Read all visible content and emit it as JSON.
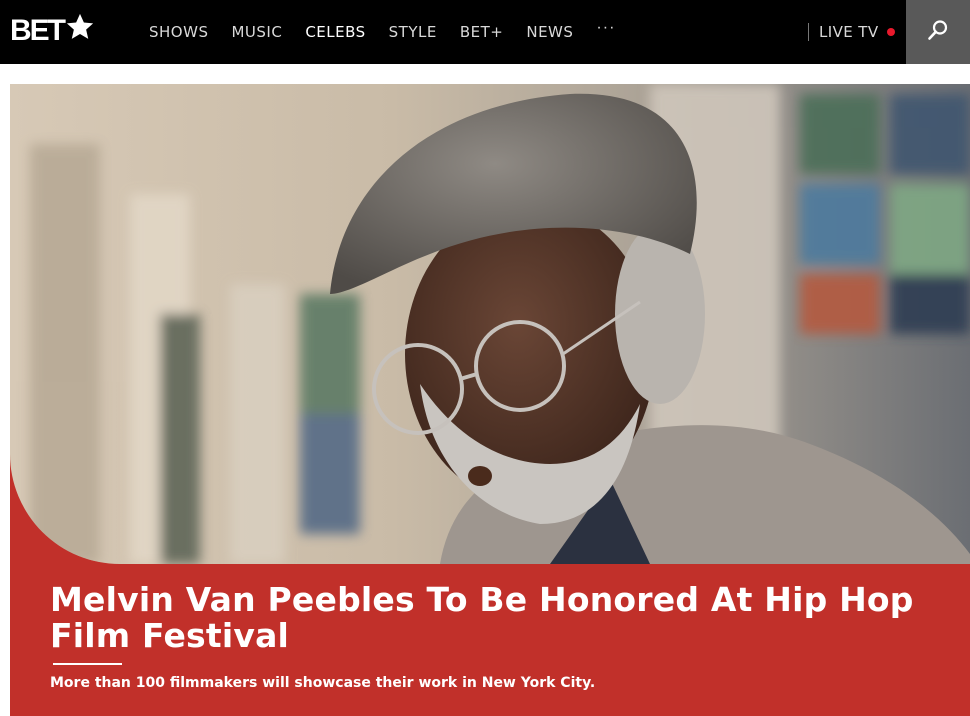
{
  "header": {
    "logo_text": "BET",
    "nav": [
      {
        "label": "SHOWS",
        "active": false
      },
      {
        "label": "MUSIC",
        "active": false
      },
      {
        "label": "CELEBS",
        "active": true
      },
      {
        "label": "STYLE",
        "active": false
      },
      {
        "label": "BET+",
        "active": false
      },
      {
        "label": "NEWS",
        "active": false
      }
    ],
    "more_label": "···",
    "live_tv_label": "LIVE TV",
    "search_icon": "search-icon"
  },
  "hero": {
    "headline": "Melvin Van Peebles To Be Honored At Hip Hop Film Festival",
    "dek": "More than 100 filmmakers will showcase their work in New York City."
  },
  "colors": {
    "header_bg": "#000000",
    "accent_red": "#c1302a",
    "live_dot": "#e8192c",
    "search_bg": "#595959"
  }
}
